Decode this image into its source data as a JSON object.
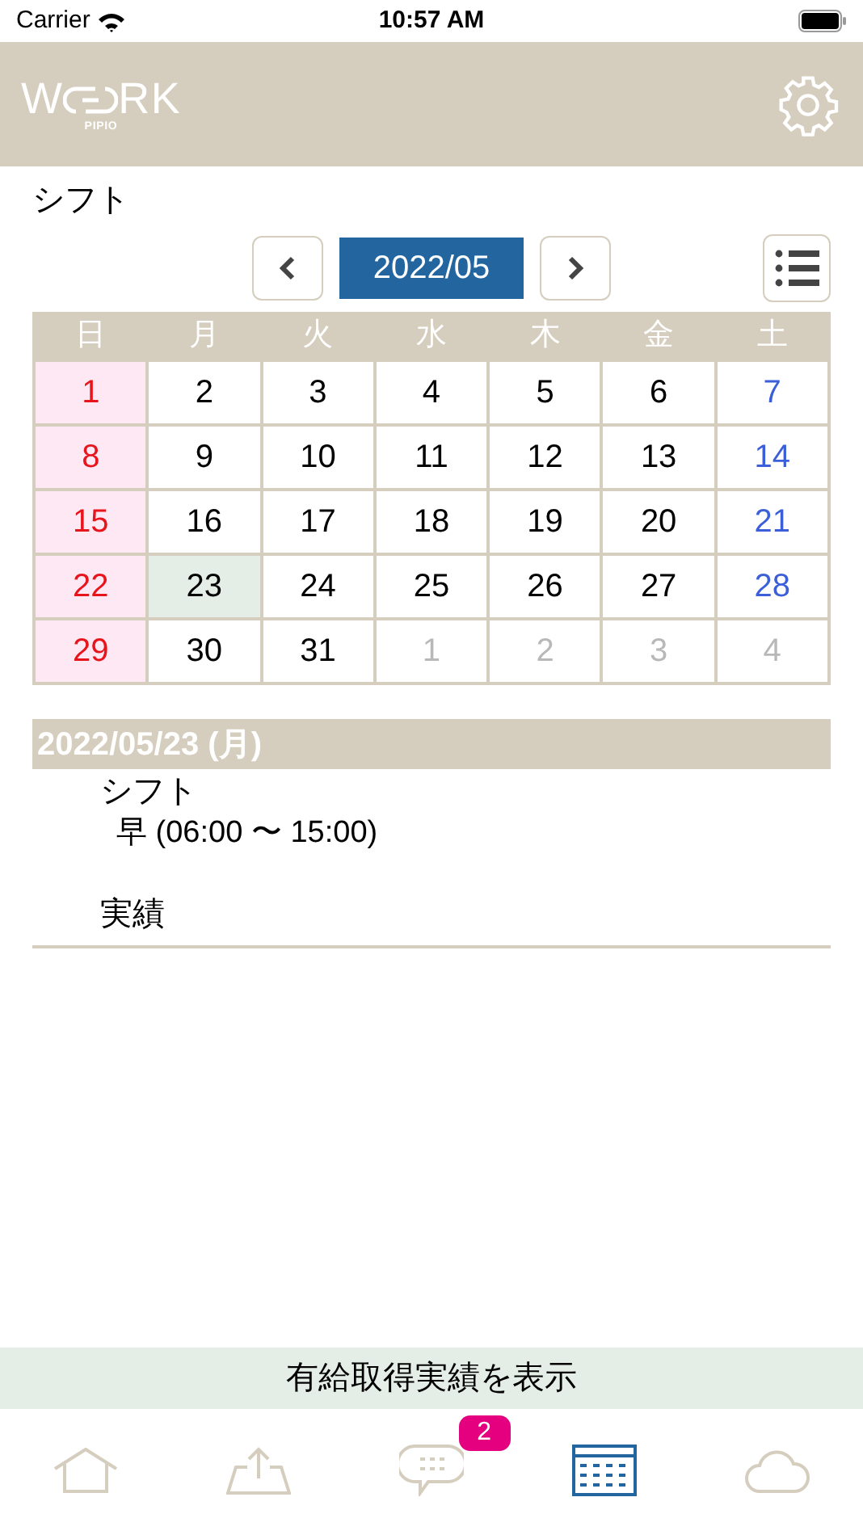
{
  "status_bar": {
    "carrier": "Carrier",
    "time": "10:57 AM"
  },
  "header": {
    "logo": {
      "left": "W",
      "right": "RK",
      "sub": "PIPIO"
    }
  },
  "page_title": "シフト",
  "month_nav": {
    "month": "2022/05"
  },
  "calendar": {
    "weekdays": [
      {
        "label": "日"
      },
      {
        "label": "月"
      },
      {
        "label": "火"
      },
      {
        "label": "水"
      },
      {
        "label": "木"
      },
      {
        "label": "金"
      },
      {
        "label": "土"
      }
    ],
    "weeks": [
      [
        {
          "day": "1",
          "kind": "sunday",
          "selected": false
        },
        {
          "day": "2",
          "kind": "normal",
          "selected": false
        },
        {
          "day": "3",
          "kind": "normal",
          "selected": false
        },
        {
          "day": "4",
          "kind": "normal",
          "selected": false
        },
        {
          "day": "5",
          "kind": "normal",
          "selected": false
        },
        {
          "day": "6",
          "kind": "normal",
          "selected": false
        },
        {
          "day": "7",
          "kind": "saturday",
          "selected": false
        }
      ],
      [
        {
          "day": "8",
          "kind": "sunday",
          "selected": false
        },
        {
          "day": "9",
          "kind": "normal",
          "selected": false
        },
        {
          "day": "10",
          "kind": "normal",
          "selected": false
        },
        {
          "day": "11",
          "kind": "normal",
          "selected": false
        },
        {
          "day": "12",
          "kind": "normal",
          "selected": false
        },
        {
          "day": "13",
          "kind": "normal",
          "selected": false
        },
        {
          "day": "14",
          "kind": "saturday",
          "selected": false
        }
      ],
      [
        {
          "day": "15",
          "kind": "sunday",
          "selected": false
        },
        {
          "day": "16",
          "kind": "normal",
          "selected": false
        },
        {
          "day": "17",
          "kind": "normal",
          "selected": false
        },
        {
          "day": "18",
          "kind": "normal",
          "selected": false
        },
        {
          "day": "19",
          "kind": "normal",
          "selected": false
        },
        {
          "day": "20",
          "kind": "normal",
          "selected": false
        },
        {
          "day": "21",
          "kind": "saturday",
          "selected": false
        }
      ],
      [
        {
          "day": "22",
          "kind": "sunday",
          "selected": false
        },
        {
          "day": "23",
          "kind": "normal",
          "selected": true
        },
        {
          "day": "24",
          "kind": "normal",
          "selected": false
        },
        {
          "day": "25",
          "kind": "normal",
          "selected": false
        },
        {
          "day": "26",
          "kind": "normal",
          "selected": false
        },
        {
          "day": "27",
          "kind": "normal",
          "selected": false
        },
        {
          "day": "28",
          "kind": "saturday",
          "selected": false
        }
      ],
      [
        {
          "day": "29",
          "kind": "sunday",
          "selected": false
        },
        {
          "day": "30",
          "kind": "normal",
          "selected": false
        },
        {
          "day": "31",
          "kind": "normal",
          "selected": false
        },
        {
          "day": "1",
          "kind": "other",
          "selected": false
        },
        {
          "day": "2",
          "kind": "other",
          "selected": false
        },
        {
          "day": "3",
          "kind": "other",
          "selected": false
        },
        {
          "day": "4",
          "kind": "other",
          "selected": false
        }
      ]
    ]
  },
  "detail": {
    "date": "2022/05/23 (月)",
    "shift_label": "シフト",
    "shift_value": "早 (06:00 〜 15:00)",
    "actual_label": "実績"
  },
  "paid_leave_button": "有給取得実績を表示",
  "tab_bar": [
    {
      "kind": "home",
      "selected": false
    },
    {
      "kind": "upload",
      "selected": false
    },
    {
      "kind": "chat",
      "selected": false,
      "badge": "2"
    },
    {
      "kind": "calendar",
      "selected": true
    },
    {
      "kind": "cloud",
      "selected": false
    }
  ]
}
